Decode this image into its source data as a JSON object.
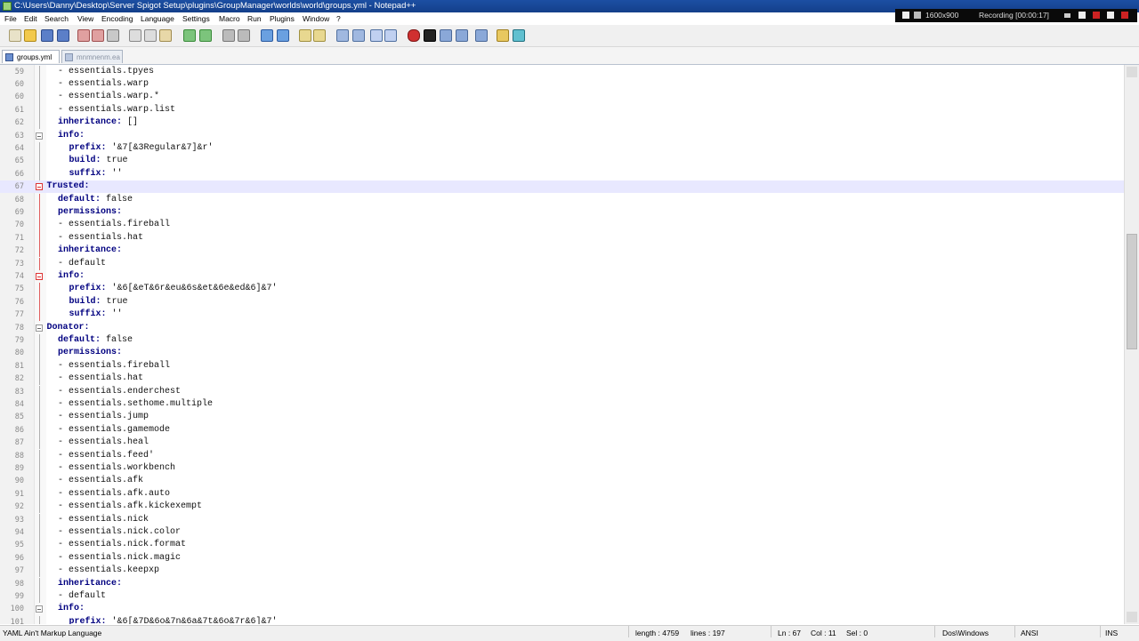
{
  "window": {
    "title": "C:\\Users\\Danny\\Desktop\\Server Spigot Setup\\plugins\\GroupManager\\worlds\\world\\groups.yml - Notepad++"
  },
  "recorder": {
    "resolution": "1600x900",
    "status": "Recording [00:00:17]"
  },
  "menu": [
    "File",
    "Edit",
    "Search",
    "View",
    "Encoding",
    "Language",
    "Settings",
    "Macro",
    "Run",
    "Plugins",
    "Window",
    "?"
  ],
  "tabs": [
    {
      "label": "groups.yml",
      "active": true
    },
    {
      "label": "mnmnenm.ea",
      "active": false
    }
  ],
  "lines": [
    {
      "n": "59",
      "text": "- essentials.tpyes",
      "indent": 2,
      "key": false,
      "fold": "line"
    },
    {
      "n": "60",
      "text": "- essentials.warp",
      "indent": 2,
      "key": false,
      "fold": "line"
    },
    {
      "n": "60",
      "text": "- essentials.warp.*",
      "indent": 2,
      "key": false,
      "fold": "line"
    },
    {
      "n": "61",
      "text": "- essentials.warp.list",
      "indent": 2,
      "key": false,
      "fold": "line"
    },
    {
      "n": "62",
      "text": "inheritance:",
      "rest": " []",
      "indent": 2,
      "key": true,
      "fold": "line"
    },
    {
      "n": "63",
      "text": "info:",
      "indent": 2,
      "key": true,
      "fold": "box"
    },
    {
      "n": "64",
      "text": "prefix:",
      "rest": " '&7[&3Regular&7]&r'",
      "indent": 3,
      "key": true,
      "fold": "line"
    },
    {
      "n": "65",
      "text": "build:",
      "rest": " true",
      "indent": 3,
      "key": true,
      "fold": "line"
    },
    {
      "n": "66",
      "text": "suffix:",
      "rest": " ''",
      "indent": 3,
      "key": true,
      "fold": "line"
    },
    {
      "n": "67",
      "text": "Trusted:",
      "indent": 1,
      "key": true,
      "fold": "boxred",
      "current": true
    },
    {
      "n": "68",
      "text": "default:",
      "rest": " false",
      "indent": 2,
      "key": true,
      "fold": "linered"
    },
    {
      "n": "69",
      "text": "permissions:",
      "indent": 2,
      "key": true,
      "fold": "linered"
    },
    {
      "n": "70",
      "text": "- essentials.fireball",
      "indent": 2,
      "key": false,
      "fold": "linered"
    },
    {
      "n": "71",
      "text": "- essentials.hat",
      "indent": 2,
      "key": false,
      "fold": "linered"
    },
    {
      "n": "72",
      "text": "inheritance:",
      "indent": 2,
      "key": true,
      "fold": "linered"
    },
    {
      "n": "73",
      "text": "- default",
      "indent": 2,
      "key": false,
      "fold": "linered"
    },
    {
      "n": "74",
      "text": "info:",
      "indent": 2,
      "key": true,
      "fold": "boxred"
    },
    {
      "n": "75",
      "text": "prefix:",
      "rest": " '&6[&eT&6r&eu&6s&et&6e&ed&6]&7'",
      "indent": 3,
      "key": true,
      "fold": "linered"
    },
    {
      "n": "76",
      "text": "build:",
      "rest": " true",
      "indent": 3,
      "key": true,
      "fold": "linered"
    },
    {
      "n": "77",
      "text": "suffix:",
      "rest": " ''",
      "indent": 3,
      "key": true,
      "fold": "linered"
    },
    {
      "n": "78",
      "text": "Donator:",
      "indent": 1,
      "key": true,
      "fold": "box"
    },
    {
      "n": "79",
      "text": "default:",
      "rest": " false",
      "indent": 2,
      "key": true,
      "fold": "line"
    },
    {
      "n": "80",
      "text": "permissions:",
      "indent": 2,
      "key": true,
      "fold": "line"
    },
    {
      "n": "81",
      "text": "- essentials.fireball",
      "indent": 2,
      "key": false,
      "fold": "line"
    },
    {
      "n": "82",
      "text": "- essentials.hat",
      "indent": 2,
      "key": false,
      "fold": "line"
    },
    {
      "n": "83",
      "text": "- essentials.enderchest",
      "indent": 2,
      "key": false,
      "fold": "line"
    },
    {
      "n": "84",
      "text": "- essentials.sethome.multiple",
      "indent": 2,
      "key": false,
      "fold": "line"
    },
    {
      "n": "85",
      "text": "- essentials.jump",
      "indent": 2,
      "key": false,
      "fold": "line"
    },
    {
      "n": "86",
      "text": "- essentials.gamemode",
      "indent": 2,
      "key": false,
      "fold": "line"
    },
    {
      "n": "87",
      "text": "- essentials.heal",
      "indent": 2,
      "key": false,
      "fold": "line"
    },
    {
      "n": "88",
      "text": "- essentials.feed'",
      "indent": 2,
      "key": false,
      "fold": "line"
    },
    {
      "n": "89",
      "text": "- essentials.workbench",
      "indent": 2,
      "key": false,
      "fold": "line"
    },
    {
      "n": "90",
      "text": "- essentials.afk",
      "indent": 2,
      "key": false,
      "fold": "line"
    },
    {
      "n": "91",
      "text": "- essentials.afk.auto",
      "indent": 2,
      "key": false,
      "fold": "line"
    },
    {
      "n": "92",
      "text": "- essentials.afk.kickexempt",
      "indent": 2,
      "key": false,
      "fold": "line"
    },
    {
      "n": "93",
      "text": "- essentials.nick",
      "indent": 2,
      "key": false,
      "fold": "line"
    },
    {
      "n": "94",
      "text": "- essentials.nick.color",
      "indent": 2,
      "key": false,
      "fold": "line"
    },
    {
      "n": "95",
      "text": "- essentials.nick.format",
      "indent": 2,
      "key": false,
      "fold": "line"
    },
    {
      "n": "96",
      "text": "- essentials.nick.magic",
      "indent": 2,
      "key": false,
      "fold": "line"
    },
    {
      "n": "97",
      "text": "- essentials.keepxp",
      "indent": 2,
      "key": false,
      "fold": "line"
    },
    {
      "n": "98",
      "text": "inheritance:",
      "indent": 2,
      "key": true,
      "fold": "line"
    },
    {
      "n": "99",
      "text": "- default",
      "indent": 2,
      "key": false,
      "fold": "line"
    },
    {
      "n": "100",
      "text": "info:",
      "indent": 2,
      "key": true,
      "fold": "box"
    },
    {
      "n": "101",
      "text": "prefix:",
      "rest": " '&6[&7D&6o&7n&6a&7t&6o&7r&6]&7'",
      "indent": 3,
      "key": true,
      "fold": "line"
    }
  ],
  "status": {
    "language": "YAML Ain't Markup Language",
    "length": "length : 4759",
    "lines": "lines : 197",
    "position": "Ln : 67",
    "col": "Col : 11",
    "sel": "Sel : 0",
    "eol": "Dos\\Windows",
    "encoding": "ANSI",
    "mode": "INS"
  },
  "colors": {
    "key": "#000080",
    "titlebar": "#1c4fa3",
    "fold_active": "#d33333"
  }
}
